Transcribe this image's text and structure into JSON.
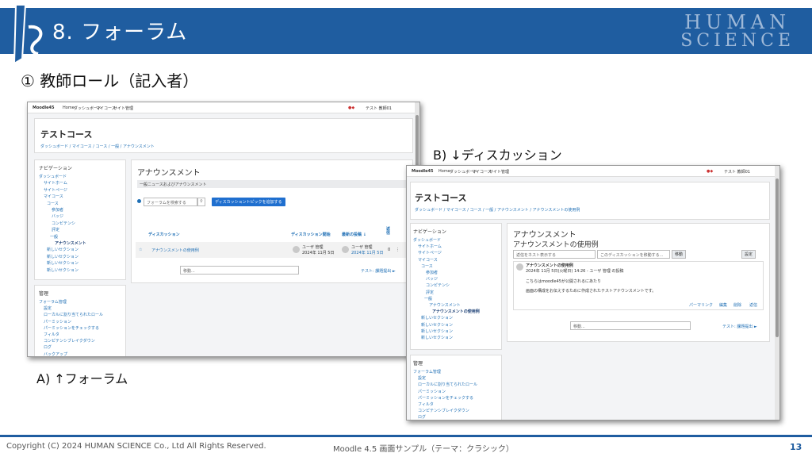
{
  "header": {
    "title": "8. フォーラム",
    "brand_line1": "HUMAN",
    "brand_line2": "SCIENCE"
  },
  "subtitle": "① 教師ロール（記入者）",
  "caption_a": "A) ↑フォーラム",
  "caption_b": "B) ↓ディスカッション",
  "footer": {
    "copyright": "Copyright (C) 2024 HUMAN SCIENCE Co., Ltd All Rights Reserved.",
    "center": "Moodle 4.5 画面サンプル（テーマ：クラシック）",
    "page": "13"
  },
  "shot_a": {
    "site_name": "Moodle45",
    "top_nav": [
      "Home",
      "ダッシュボード",
      "マイコース",
      "サイト管理"
    ],
    "user_label": "テスト 教師01",
    "course_title": "テストコース",
    "breadcrumb": "ダッシュボード / マイコース / コース / 一般 / アナウンスメント",
    "nav_heading": "ナビゲーション",
    "nav_items": [
      "ダッシュボード",
      "サイトホーム",
      "サイトページ",
      "マイコース",
      "コース",
      "参加者",
      "バッジ",
      "コンピテンシ",
      "評定",
      "一般",
      "アナウンスメント",
      "新しいセクション",
      "新しいセクション",
      "新しいセクション",
      "新しいセクション"
    ],
    "admin_heading": "管理",
    "admin_items": [
      "フォーラム管理",
      "設定",
      "ローカルに割り当てられたロール",
      "パーミッション",
      "パーミッションをチェックする",
      "フィルタ",
      "コンピテンシブレイクダウン",
      "ログ",
      "バックアップ"
    ],
    "page_title": "アナウンスメント",
    "intro": "一般ニュースおよびアナウンスメント",
    "search_placeholder": "フォーラムを検索する",
    "add_button": "ディスカッショントピックを追加する",
    "col_discussion": "ディスカッション",
    "col_started": "ディスカッション開始",
    "col_last_post": "最新の投稿 ↓",
    "col_replies": "返信",
    "row_title": "アナウンスメントの使用例",
    "row_author": "ユーザ 管理",
    "row_date": "2024年 11月 5日",
    "row_replies": "0",
    "jump_select": "移動...",
    "next_link": "テスト: 課題提出 ►"
  },
  "shot_b": {
    "site_name": "Moodle45",
    "top_nav": [
      "Home",
      "ダッシュボード",
      "マイコース",
      "サイト管理"
    ],
    "user_label": "テスト 教師01",
    "course_title": "テストコース",
    "breadcrumb": "ダッシュボード / マイコース / コース / 一般 / アナウンスメント / アナウンスメントの使用例",
    "nav_heading": "ナビゲーション",
    "nav_items": [
      "ダッシュボード",
      "サイトホーム",
      "サイトページ",
      "マイコース",
      "コース",
      "参加者",
      "バッジ",
      "コンピテンシ",
      "評定",
      "一般",
      "アナウンスメント",
      "アナウンスメントの使用例",
      "新しいセクション",
      "新しいセクション",
      "新しいセクション",
      "新しいセクション"
    ],
    "admin_heading": "管理",
    "admin_items": [
      "フォーラム管理",
      "設定",
      "ローカルに割り当てられたロール",
      "パーミッション",
      "パーミッションをチェックする",
      "フィルタ",
      "コンピテンシブレイクダウン",
      "ログ"
    ],
    "page_title": "アナウンスメント",
    "discussion_title": "アナウンスメントの使用例",
    "display_mode": "返信をネスト表示する",
    "move_select": "このディスカッションを移動する...",
    "move_button": "移動",
    "settings_button": "設定",
    "post_title": "アナウンスメントの使用例",
    "post_meta": "2024年 11月 5日(火曜日) 14:26 - ユーザ 管理 の投稿",
    "post_body1": "こちらはmoodle45が公開されるにあたり",
    "post_body2": "画面の構成をお伝えするために作成されたテストアナウンスメントです。",
    "post_actions": [
      "パーマリンク",
      "編集",
      "削除",
      "返信"
    ],
    "jump_select": "移動...",
    "next_link": "テスト: 課題提出 ►"
  }
}
